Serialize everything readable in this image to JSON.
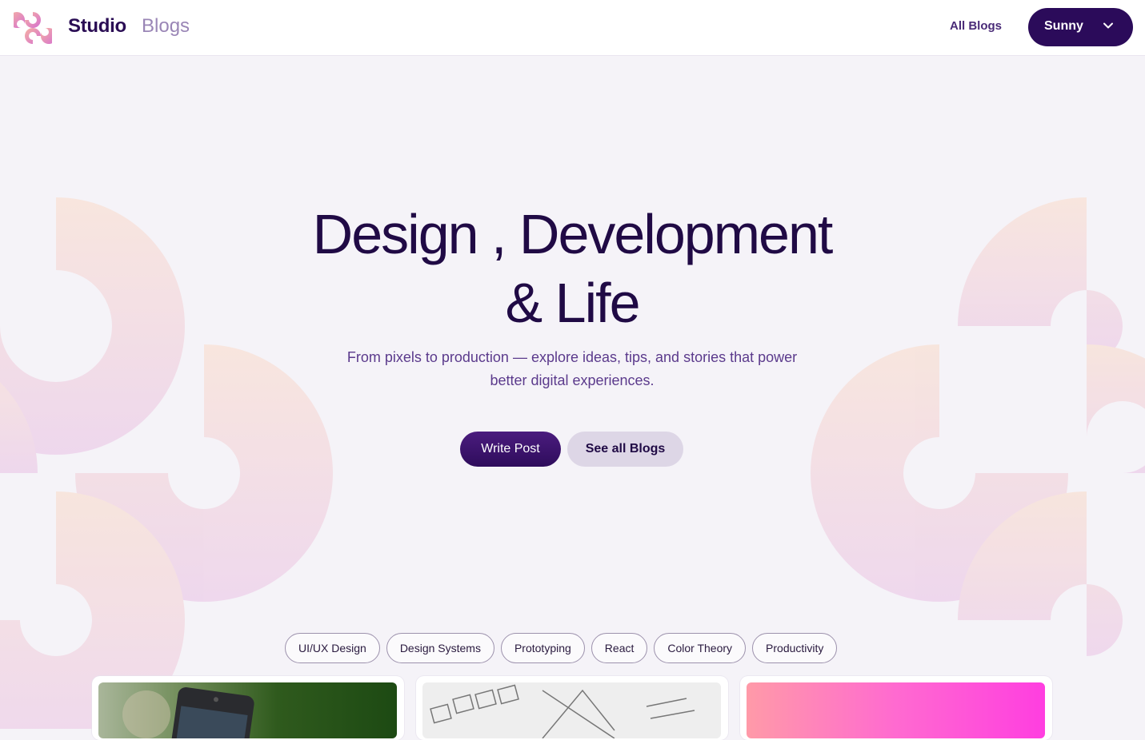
{
  "header": {
    "brand": "Studio",
    "brand_sub": "Blogs",
    "nav_link": "All Blogs",
    "user_name": "Sunny",
    "icons": {
      "logo": "studio-logo-icon",
      "dropdown": "chevron-down-icon"
    }
  },
  "hero": {
    "title_line1": "Design , Development",
    "title_line2": "& Life",
    "subtitle_line1": "From pixels to production — explore ideas, tips, and stories that power",
    "subtitle_line2": "better digital experiences.",
    "primary_button": "Write Post",
    "secondary_button": "See all Blogs"
  },
  "tags": [
    "UI/UX Design",
    "Design Systems",
    "Prototyping",
    "React",
    "Color Theory",
    "Productivity"
  ],
  "colors": {
    "brand_dark": "#2b0b5a",
    "accent_purple": "#4b1c7e",
    "background": "#f5f3f8",
    "decor_peach": "#f8e3dc",
    "decor_pink": "#f0d7ea"
  }
}
